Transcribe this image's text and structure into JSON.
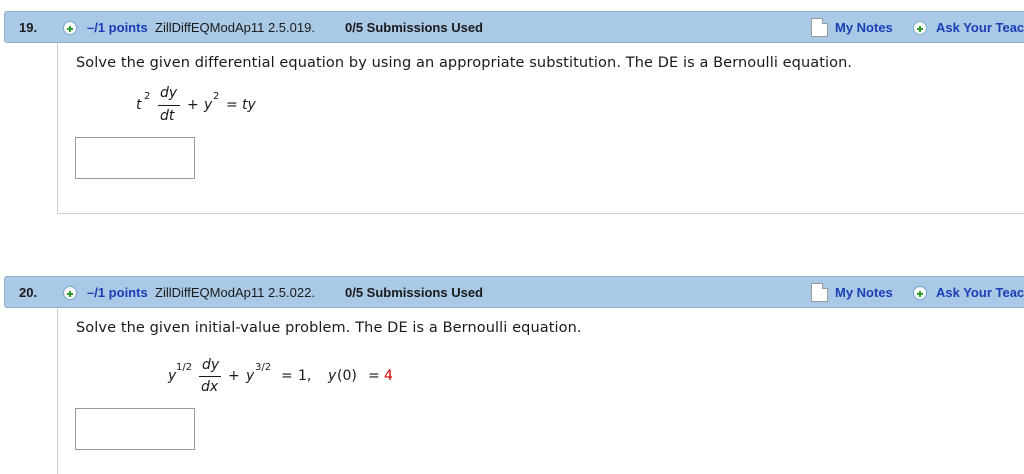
{
  "questions": [
    {
      "number": "19.",
      "points": "–/1 points",
      "source": "ZillDiffEQModAp11 2.5.019.",
      "submissions": "0/5 Submissions Used",
      "my_notes": "My Notes",
      "ask_teacher": "Ask Your Teacher",
      "prompt": "Solve the given differential equation by using an appropriate substitution. The DE is a Bernoulli equation.",
      "equation": {
        "lhs_coef": "t",
        "lhs_coef_exp": "2",
        "frac_num": "dy",
        "frac_den": "dt",
        "plus": "+",
        "term": "y",
        "term_exp": "2",
        "equals": "=",
        "rhs": "ty"
      },
      "answer_value": ""
    },
    {
      "number": "20.",
      "points": "–/1 points",
      "source": "ZillDiffEQModAp11 2.5.022.",
      "submissions": "0/5 Submissions Used",
      "my_notes": "My Notes",
      "ask_teacher": "Ask Your Teacher",
      "prompt": "Solve the given initial-value problem. The DE is a Bernoulli equation.",
      "equation": {
        "lhs_coef": "y",
        "lhs_coef_exp": "1/2",
        "frac_num": "dy",
        "frac_den": "dx",
        "plus": "+",
        "term": "y",
        "term_exp": "3/2",
        "equals": "=",
        "rhs": "1,",
        "ic_lhs": "y",
        "ic_paren": "(0)",
        "ic_equals": "=",
        "ic_value": "4"
      },
      "answer_value": ""
    }
  ],
  "colors": {
    "header_bg": "#a9c9e6",
    "link": "#1a3eb5",
    "plus_icon": "#2e9d2e",
    "given_value": "#d40000"
  },
  "icons": {
    "points": "plus-circle-icon",
    "notes": "note-page-icon",
    "ask": "plus-circle-icon"
  }
}
